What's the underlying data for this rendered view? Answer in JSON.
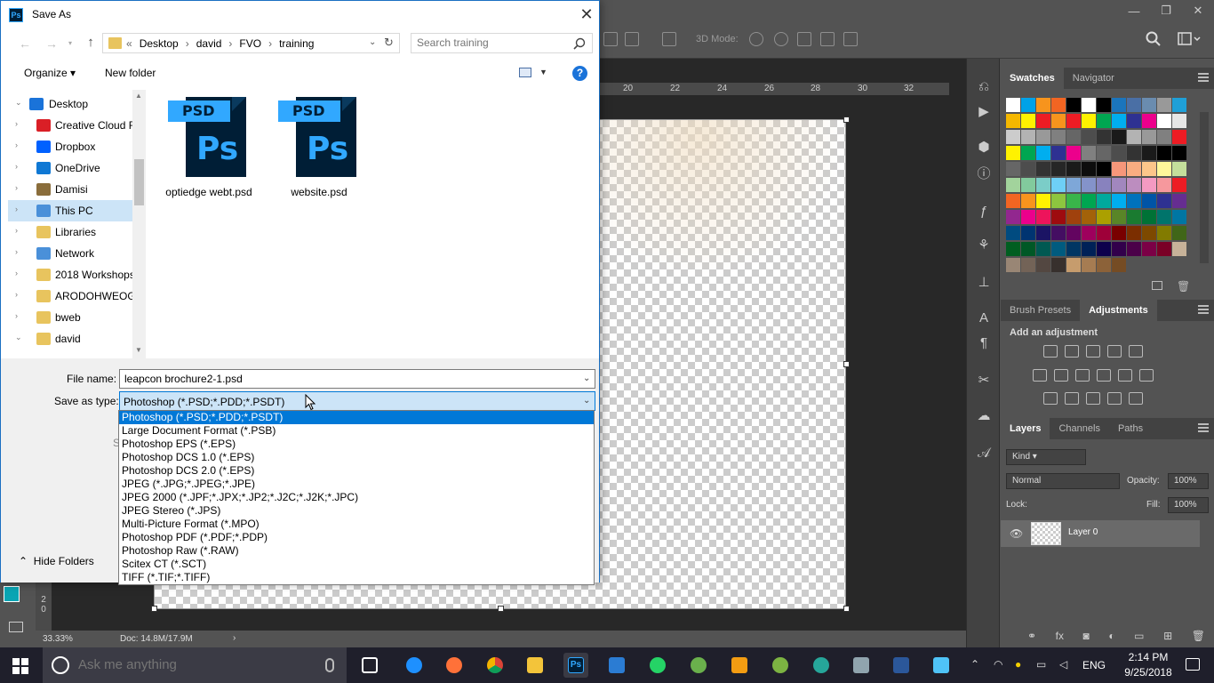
{
  "dialog": {
    "title": "Save As",
    "close_glyph": "✕",
    "breadcrumb": [
      "Desktop",
      "david",
      "FVO",
      "training"
    ],
    "breadcrumb_prefix": "«",
    "search_placeholder": "Search training",
    "organize_label": "Organize ▾",
    "new_folder_label": "New folder",
    "help_glyph": "?",
    "nav_items": [
      {
        "label": "Desktop",
        "icon": "desktop-icon",
        "arrow": "⌄"
      },
      {
        "label": "Creative Cloud F",
        "icon": "creative-cloud-icon",
        "arrow": "›"
      },
      {
        "label": "Dropbox",
        "icon": "dropbox-icon",
        "arrow": "›"
      },
      {
        "label": "OneDrive",
        "icon": "onedrive-icon",
        "arrow": "›"
      },
      {
        "label": "Damisi",
        "icon": "user-icon",
        "arrow": "›"
      },
      {
        "label": "This PC",
        "icon": "computer-icon",
        "arrow": "›",
        "selected": true
      },
      {
        "label": "Libraries",
        "icon": "libraries-icon",
        "arrow": "›"
      },
      {
        "label": "Network",
        "icon": "network-icon",
        "arrow": "›"
      },
      {
        "label": "2018 Workshops",
        "icon": "folder-icon",
        "arrow": "›"
      },
      {
        "label": "ARODOHWEOGI",
        "icon": "folder-icon",
        "arrow": "›"
      },
      {
        "label": "bweb",
        "icon": "folder-icon",
        "arrow": "›"
      },
      {
        "label": "david",
        "icon": "folder-icon",
        "arrow": "⌄"
      }
    ],
    "files": [
      {
        "name": "optiedge webt.psd"
      },
      {
        "name": "website.psd"
      }
    ],
    "psd_band": "PSD",
    "psd_letters": "Ps",
    "file_name_label": "File name:",
    "file_name_value": "leapcon brochure2-1.psd",
    "save_type_label": "Save as type:",
    "save_type_value": "Photoshop (*.PSD;*.PDD;*.PSDT)",
    "save_type_options": [
      "Photoshop (*.PSD;*.PDD;*.PSDT)",
      "Large Document Format (*.PSB)",
      "Photoshop EPS (*.EPS)",
      "Photoshop DCS 1.0 (*.EPS)",
      "Photoshop DCS 2.0 (*.EPS)",
      "JPEG (*.JPG;*.JPEG;*.JPE)",
      "JPEG 2000 (*.JPF;*.JPX;*.JP2;*.J2C;*.J2K;*.JPC)",
      "JPEG Stereo (*.JPS)",
      "Multi-Picture Format (*.MPO)",
      "Photoshop PDF (*.PDF;*.PDP)",
      "Photoshop Raw (*.RAW)",
      "Scitex CT (*.SCT)",
      "TIFF (*.TIF;*.TIFF)"
    ],
    "hidden_partial_label": "S",
    "hide_folders_label": "Hide Folders"
  },
  "photoshop": {
    "options_3d_mode": "3D Mode:",
    "ruler_ticks": [
      "20",
      "22",
      "24",
      "26",
      "28",
      "30",
      "32"
    ],
    "left_ruler": "2\n0",
    "zoom": "33.33%",
    "doc_size": "Doc: 14.8M/17.9M",
    "status_arrow": "›",
    "panel_tabs_top": [
      "Swatches",
      "Navigator"
    ],
    "panel_tabs_mid": [
      "Brush Presets",
      "Adjustments"
    ],
    "add_adjustment": "Add an adjustment",
    "panel_tabs_layers": [
      "Layers",
      "Channels",
      "Paths"
    ],
    "kind_label": "Kind",
    "blend_mode": "Normal",
    "opacity_label": "Opacity:",
    "opacity_value": "100%",
    "lock_label": "Lock:",
    "fill_label": "Fill:",
    "fill_value": "100%",
    "layer_name": "Layer 0",
    "swatch_colors": [
      "#ffffff",
      "#00a2e8",
      "#f7941d",
      "#f26522",
      "#000000",
      "#ffffff",
      "#000000",
      "#1b75bc",
      "#4a6fa5",
      "#6a8caf",
      "#999999",
      "#1fa0d8",
      "#f5b800",
      "#fff200",
      "#ed1c24",
      "#f7941d",
      "#ed1c24",
      "#fff200",
      "#00a651",
      "#00aeef",
      "#2e3192",
      "#ec008c",
      "#ffffff",
      "#e6e6e6",
      "#cccccc",
      "#b3b3b3",
      "#999999",
      "#808080",
      "#666666",
      "#4d4d4d",
      "#333333",
      "#1a1a1a",
      "#b3b3b3",
      "#999999",
      "#808080",
      "#ed1c24",
      "#fff200",
      "#00a651",
      "#00aeef",
      "#2e3192",
      "#ec008c",
      "#808080",
      "#666666",
      "#4d4d4d",
      "#333333",
      "#1a1a1a",
      "#000000",
      "#000000",
      "#666666",
      "#4d4d4d",
      "#333333",
      "#262626",
      "#1a1a1a",
      "#0d0d0d",
      "#000000",
      "#f7977a",
      "#f9ad81",
      "#fdc68a",
      "#fff79a",
      "#c4df9b",
      "#a2d39c",
      "#82ca9d",
      "#7bcdc8",
      "#6ecff6",
      "#7ea7d8",
      "#8493ca",
      "#8882be",
      "#a187be",
      "#bc8dbf",
      "#f49ac2",
      "#f6989d",
      "#ed1c24",
      "#f26522",
      "#f7941d",
      "#fff200",
      "#8dc63f",
      "#39b54a",
      "#00a651",
      "#00a99d",
      "#00aeef",
      "#0072bc",
      "#0054a6",
      "#2e3192",
      "#662d91",
      "#92278f",
      "#ec008c",
      "#ed145b",
      "#9e0b0f",
      "#a0410d",
      "#a36209",
      "#aba000",
      "#598527",
      "#1a7b30",
      "#007236",
      "#00746b",
      "#0076a3",
      "#004b80",
      "#003471",
      "#1b1464",
      "#440e62",
      "#630460",
      "#9e005d",
      "#9e0039",
      "#790000",
      "#7b2e00",
      "#7d4900",
      "#827b00",
      "#406618",
      "#005e20",
      "#005826",
      "#005952",
      "#005b7f",
      "#003663",
      "#002157",
      "#0d004c",
      "#32004b",
      "#4b0049",
      "#7b0046",
      "#7a0026",
      "#c7b299",
      "#998675",
      "#736357",
      "#534741",
      "#37302d",
      "#c69c6d",
      "#a67c52",
      "#8c6239",
      "#754c24"
    ]
  },
  "taskbar": {
    "search_placeholder": "Ask me anything",
    "language": "ENG",
    "time": "2:14 PM",
    "date": "9/25/2018"
  }
}
